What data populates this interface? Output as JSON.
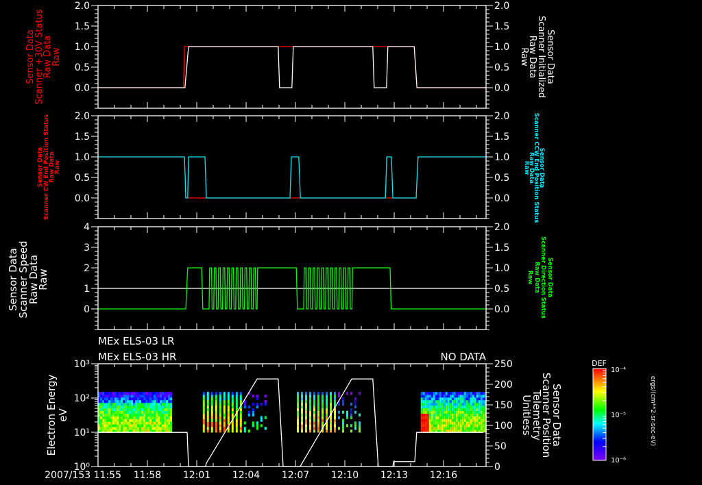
{
  "time_axis": {
    "start": "11:55:00",
    "end": "12:18:35",
    "date_label": "2007/153",
    "tick_labels": [
      "11:55",
      "11:58",
      "12:01",
      "12:04",
      "12:07",
      "12:10",
      "12:13",
      "12:16"
    ],
    "tick_times": [
      "11:55:00",
      "11:58:00",
      "12:01:00",
      "12:04:00",
      "12:07:00",
      "12:10:00",
      "12:13:00",
      "12:16:00"
    ]
  },
  "colors": {
    "red": "#ff0000",
    "white": "#ffffff",
    "cyan": "#00e8f8",
    "green": "#00ff00",
    "background": "#000000"
  },
  "chart_data": [
    {
      "type": "line",
      "left_label": [
        "Sensor Data",
        "Scanner +30V Status",
        "Raw Data",
        "Raw"
      ],
      "right_label": [
        "Sensor Data",
        "Scanner Initialized",
        "Raw Data",
        "Raw"
      ],
      "left_axis": {
        "range": [
          -0.5,
          2.0
        ],
        "ticks": [
          0,
          0.5,
          1,
          1.5,
          2
        ],
        "tick_labels": [
          "0.0",
          "0.5",
          "1.0",
          "1.5",
          "2.0"
        ],
        "color": "#ff0000"
      },
      "right_axis": {
        "range": [
          -0.5,
          2.0
        ],
        "ticks": [
          0,
          0.5,
          1,
          1.5,
          2
        ],
        "tick_labels": [
          "0.0",
          "0.5",
          "1.0",
          "1.5",
          "2.0"
        ],
        "color": "#ffffff"
      },
      "series": [
        {
          "axis": "left",
          "color": "#ff0000",
          "points": [
            [
              "11:55:00",
              0
            ],
            [
              "12:00:12",
              0
            ],
            [
              "12:00:15",
              1
            ],
            [
              "12:14:13",
              1
            ],
            [
              "12:14:23",
              0
            ],
            [
              "12:18:35",
              0
            ]
          ]
        },
        {
          "axis": "right",
          "color": "#ffffff",
          "points": [
            [
              "11:55:00",
              0
            ],
            [
              "12:00:17",
              0
            ],
            [
              "12:00:30",
              1
            ],
            [
              "12:05:57",
              1
            ],
            [
              "12:06:02",
              0
            ],
            [
              "12:06:47",
              0
            ],
            [
              "12:06:52",
              1
            ],
            [
              "12:11:42",
              1
            ],
            [
              "12:11:47",
              0
            ],
            [
              "12:12:32",
              0
            ],
            [
              "12:12:37",
              1
            ],
            [
              "12:14:13",
              1
            ],
            [
              "12:14:23",
              0
            ],
            [
              "12:18:35",
              0
            ]
          ]
        }
      ]
    },
    {
      "type": "line",
      "left_label": [
        "Sensor Data",
        "Scanner CW End Position Status",
        "Raw Data",
        "Raw"
      ],
      "right_label": [
        "Sensor Data",
        "Scanner CCW End Position Status",
        "Raw Data",
        "Raw"
      ],
      "left_axis": {
        "range": [
          -0.5,
          2.0
        ],
        "ticks": [
          0,
          0.5,
          1,
          1.5,
          2
        ],
        "tick_labels": [
          "0.0",
          "0.5",
          "1.0",
          "1.5",
          "2.0"
        ],
        "color": "#ff0000"
      },
      "right_axis": {
        "range": [
          -0.5,
          2.0
        ],
        "ticks": [
          0,
          0.5,
          1,
          1.5,
          2
        ],
        "tick_labels": [
          "0.0",
          "0.5",
          "1.0",
          "1.5",
          "2.0"
        ],
        "color": "#00e8f8"
      },
      "series": [
        {
          "axis": "left",
          "color": "#ff0000",
          "points": [
            [
              "11:55:00",
              1
            ],
            [
              "12:00:15",
              1
            ],
            [
              "12:00:20",
              0
            ],
            [
              "12:14:20",
              0
            ],
            [
              "12:14:27",
              1
            ],
            [
              "12:18:35",
              1
            ]
          ]
        },
        {
          "axis": "right",
          "color": "#00e8f8",
          "points": [
            [
              "11:55:00",
              1
            ],
            [
              "12:00:15",
              1
            ],
            [
              "12:00:18",
              0.5
            ],
            [
              "12:00:20",
              0
            ],
            [
              "12:00:27",
              0
            ],
            [
              "12:00:30",
              1
            ],
            [
              "12:01:30",
              1
            ],
            [
              "12:01:35",
              0
            ],
            [
              "12:06:40",
              0
            ],
            [
              "12:06:45",
              1
            ],
            [
              "12:07:12",
              1
            ],
            [
              "12:07:18",
              0
            ],
            [
              "12:12:28",
              0
            ],
            [
              "12:12:33",
              1
            ],
            [
              "12:12:50",
              1
            ],
            [
              "12:12:55",
              0
            ],
            [
              "12:14:20",
              0
            ],
            [
              "12:14:27",
              1
            ],
            [
              "12:18:35",
              1
            ]
          ]
        }
      ]
    },
    {
      "type": "line",
      "left_label": [
        "Sensor Data",
        "Scanner Speed",
        "Raw Data",
        "Raw"
      ],
      "right_label": [
        "Sensor Data",
        "Scanner Direction Status",
        "Raw Data",
        "Raw"
      ],
      "left_axis": {
        "range": [
          -1,
          4
        ],
        "ticks": [
          0,
          1,
          2,
          3,
          4
        ],
        "tick_labels": [
          "0",
          "1",
          "2",
          "3",
          "4"
        ],
        "color": "#ffffff"
      },
      "right_axis": {
        "range": [
          -0.5,
          2.0
        ],
        "ticks": [
          0,
          0.5,
          1,
          1.5,
          2
        ],
        "tick_labels": [
          "0.0",
          "0.5",
          "1.0",
          "1.5",
          "2.0"
        ],
        "color": "#00ff00"
      },
      "series": [
        {
          "axis": "left",
          "color": "#ffffff",
          "points": [
            [
              "11:55:00",
              1
            ],
            [
              "12:18:35",
              1
            ]
          ]
        },
        {
          "axis": "right",
          "color": "#00ff00",
          "points": [
            [
              "11:55:00",
              0
            ],
            [
              "12:00:20",
              0
            ],
            [
              "12:00:27",
              1
            ],
            [
              "12:01:18",
              1
            ],
            [
              "12:01:22",
              0
            ],
            [
              "12:01:45",
              0
            ],
            [
              "12:01:47",
              1
            ],
            [
              "12:01:54",
              1
            ],
            [
              "12:01:56",
              0
            ],
            [
              "12:02:02",
              0
            ],
            [
              "12:02:04",
              1
            ],
            [
              "12:02:10",
              1
            ],
            [
              "12:02:12",
              0
            ],
            [
              "12:02:18",
              0
            ],
            [
              "12:02:20",
              1
            ],
            [
              "12:02:26",
              1
            ],
            [
              "12:02:28",
              0
            ],
            [
              "12:02:34",
              0
            ],
            [
              "12:02:36",
              1
            ],
            [
              "12:02:42",
              1
            ],
            [
              "12:02:44",
              0
            ],
            [
              "12:02:50",
              0
            ],
            [
              "12:02:52",
              1
            ],
            [
              "12:02:58",
              1
            ],
            [
              "12:03:00",
              0
            ],
            [
              "12:03:06",
              0
            ],
            [
              "12:03:08",
              1
            ],
            [
              "12:03:14",
              1
            ],
            [
              "12:03:16",
              0
            ],
            [
              "12:03:22",
              0
            ],
            [
              "12:03:24",
              1
            ],
            [
              "12:03:30",
              1
            ],
            [
              "12:03:32",
              0
            ],
            [
              "12:03:38",
              0
            ],
            [
              "12:03:40",
              1
            ],
            [
              "12:03:46",
              1
            ],
            [
              "12:03:48",
              0
            ],
            [
              "12:03:54",
              0
            ],
            [
              "12:03:56",
              1
            ],
            [
              "12:04:02",
              1
            ],
            [
              "12:04:04",
              0
            ],
            [
              "12:04:10",
              0
            ],
            [
              "12:04:12",
              1
            ],
            [
              "12:04:18",
              1
            ],
            [
              "12:04:20",
              0
            ],
            [
              "12:04:26",
              0
            ],
            [
              "12:04:28",
              1
            ],
            [
              "12:04:34",
              1
            ],
            [
              "12:04:36",
              0
            ],
            [
              "12:04:40",
              0
            ],
            [
              "12:04:42",
              1
            ],
            [
              "12:07:03",
              1
            ],
            [
              "12:07:07",
              0
            ],
            [
              "12:07:30",
              0
            ],
            [
              "12:07:32",
              1
            ],
            [
              "12:07:38",
              1
            ],
            [
              "12:07:40",
              0
            ],
            [
              "12:07:46",
              0
            ],
            [
              "12:07:48",
              1
            ],
            [
              "12:07:54",
              1
            ],
            [
              "12:07:56",
              0
            ],
            [
              "12:08:02",
              0
            ],
            [
              "12:08:04",
              1
            ],
            [
              "12:08:10",
              1
            ],
            [
              "12:08:12",
              0
            ],
            [
              "12:08:18",
              0
            ],
            [
              "12:08:20",
              1
            ],
            [
              "12:08:26",
              1
            ],
            [
              "12:08:28",
              0
            ],
            [
              "12:08:34",
              0
            ],
            [
              "12:08:36",
              1
            ],
            [
              "12:08:42",
              1
            ],
            [
              "12:08:44",
              0
            ],
            [
              "12:08:50",
              0
            ],
            [
              "12:08:52",
              1
            ],
            [
              "12:08:58",
              1
            ],
            [
              "12:09:00",
              0
            ],
            [
              "12:09:06",
              0
            ],
            [
              "12:09:08",
              1
            ],
            [
              "12:09:14",
              1
            ],
            [
              "12:09:16",
              0
            ],
            [
              "12:09:22",
              0
            ],
            [
              "12:09:24",
              1
            ],
            [
              "12:09:30",
              1
            ],
            [
              "12:09:32",
              0
            ],
            [
              "12:09:38",
              0
            ],
            [
              "12:09:40",
              1
            ],
            [
              "12:09:46",
              1
            ],
            [
              "12:09:48",
              0
            ],
            [
              "12:09:54",
              0
            ],
            [
              "12:09:56",
              1
            ],
            [
              "12:10:02",
              1
            ],
            [
              "12:10:04",
              0
            ],
            [
              "12:10:10",
              0
            ],
            [
              "12:10:12",
              1
            ],
            [
              "12:10:18",
              1
            ],
            [
              "12:10:20",
              0
            ],
            [
              "12:10:26",
              0
            ],
            [
              "12:10:28",
              1
            ],
            [
              "12:12:45",
              1
            ],
            [
              "12:12:49",
              0
            ],
            [
              "12:18:35",
              0
            ]
          ]
        }
      ]
    },
    {
      "type": "heatmap",
      "titles": [
        "MEx ELS-03 LR",
        "MEx ELS-03 HR"
      ],
      "status": "NO DATA",
      "left_label": [
        "Electron Energy",
        "eV"
      ],
      "right_label": [
        "Sensor Data",
        "Scanner Position",
        "Telemetry",
        "Unitless"
      ],
      "left_axis": {
        "scale": "log",
        "range": [
          1,
          1000
        ],
        "ticks": [
          1,
          10,
          100,
          1000
        ],
        "tick_labels": [
          "10⁰",
          "10¹",
          "10²",
          "10³"
        ],
        "color": "#ffffff"
      },
      "right_axis": {
        "range": [
          0,
          250
        ],
        "ticks": [
          0,
          50,
          100,
          150,
          200,
          250
        ],
        "tick_labels": [
          "0",
          "50",
          "100",
          "150",
          "200",
          "250"
        ],
        "color": "#ffffff"
      },
      "spectrogram": {
        "energy_range_eV": [
          10,
          150
        ],
        "blocks": [
          {
            "start": "11:55:00",
            "end": "11:59:25",
            "striped": false
          },
          {
            "start": "12:01:22",
            "end": "12:05:17",
            "striped": true
          },
          {
            "start": "12:07:05",
            "end": "12:11:00",
            "striped": true
          },
          {
            "start": "12:14:37",
            "end": "12:18:35",
            "striped": false
          }
        ]
      },
      "colorbar": {
        "title": "DEF",
        "scale": "log",
        "range": [
          1e-06,
          0.0001
        ],
        "tick_labels": [
          "10⁻⁴",
          "10⁻⁵",
          "10⁻⁶"
        ],
        "unit": "ergs/(cm**2-sr-sec-eV)"
      },
      "series": [
        {
          "axis": "right",
          "color": "#ffffff",
          "points": [
            [
              "11:55:00",
              83
            ],
            [
              "12:00:25",
              83
            ],
            [
              "12:00:30",
              0
            ],
            [
              "12:01:32",
              0
            ],
            [
              "12:01:35",
              8
            ],
            [
              "12:04:40",
              213
            ],
            [
              "12:05:57",
              213
            ],
            [
              "12:06:15",
              0
            ],
            [
              "12:07:17",
              0
            ],
            [
              "12:10:25",
              213
            ],
            [
              "12:11:42",
              213
            ],
            [
              "12:12:02",
              0
            ],
            [
              "12:12:55",
              0
            ],
            [
              "12:12:58",
              12
            ],
            [
              "12:14:15",
              12
            ],
            [
              "12:14:22",
              83
            ],
            [
              "12:18:25",
              83
            ]
          ]
        }
      ]
    }
  ]
}
